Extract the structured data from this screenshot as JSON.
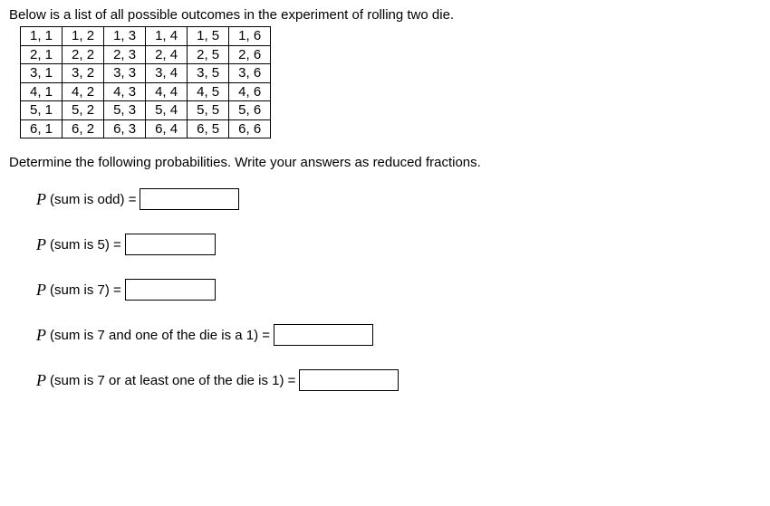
{
  "intro": "Below is a list of all possible outcomes in the experiment of rolling two die.",
  "outcomes": {
    "rows": [
      [
        "1, 1",
        "1, 2",
        "1, 3",
        "1, 4",
        "1, 5",
        "1, 6"
      ],
      [
        "2, 1",
        "2, 2",
        "2, 3",
        "2, 4",
        "2, 5",
        "2, 6"
      ],
      [
        "3, 1",
        "3, 2",
        "3, 3",
        "3, 4",
        "3, 5",
        "3, 6"
      ],
      [
        "4, 1",
        "4, 2",
        "4, 3",
        "4, 4",
        "4, 5",
        "4, 6"
      ],
      [
        "5, 1",
        "5, 2",
        "5, 3",
        "5, 4",
        "5, 5",
        "5, 6"
      ],
      [
        "6, 1",
        "6, 2",
        "6, 3",
        "6, 4",
        "6, 5",
        "6, 6"
      ]
    ]
  },
  "instruction": "Determine the following probabilities. Write your answers as reduced fractions.",
  "questions": [
    {
      "pvar": "P",
      "text": "(sum is odd) ="
    },
    {
      "pvar": "P",
      "text": "(sum is 5) ="
    },
    {
      "pvar": "P",
      "text": "(sum is 7) ="
    },
    {
      "pvar": "P",
      "text": "(sum is 7 and one of the die is a 1) ="
    },
    {
      "pvar": "P",
      "text": "(sum is 7 or at least one of the die is 1) ="
    }
  ]
}
